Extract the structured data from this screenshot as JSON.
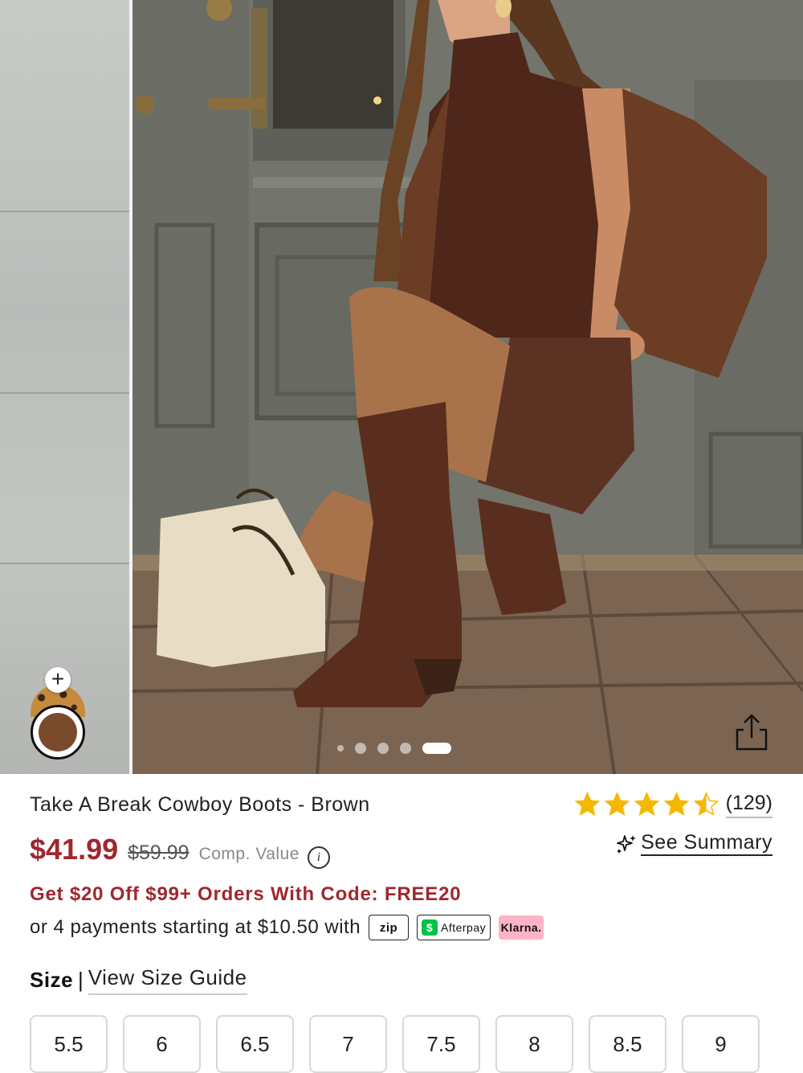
{
  "product": {
    "title": "Take A Break Cowboy Boots - Brown",
    "rating": 4.5,
    "review_count": "(129)",
    "price": "$41.99",
    "compare_price": "$59.99",
    "compare_label": "Comp. Value",
    "summary_link": "See Summary"
  },
  "gallery": {
    "slide_count": 5,
    "active_slide": 5,
    "swatch_add": "+",
    "colors": {
      "selected_swatch": "#7a4a2c",
      "secondary_swatch": "#c58b3d"
    }
  },
  "promo": {
    "text": "Get $20 Off $99+ Orders With Code: FREE20"
  },
  "payments": {
    "text": "or 4 payments starting at $10.50 with",
    "providers": [
      "zip",
      "Afterpay",
      "Klarna."
    ]
  },
  "size": {
    "label": "Size",
    "separator": "|",
    "guide_link": "View Size Guide",
    "options": [
      "5.5",
      "6",
      "6.5",
      "7",
      "7.5",
      "8",
      "8.5",
      "9"
    ]
  },
  "colors": {
    "accent": "#a0272f",
    "star": "#f5b800"
  }
}
